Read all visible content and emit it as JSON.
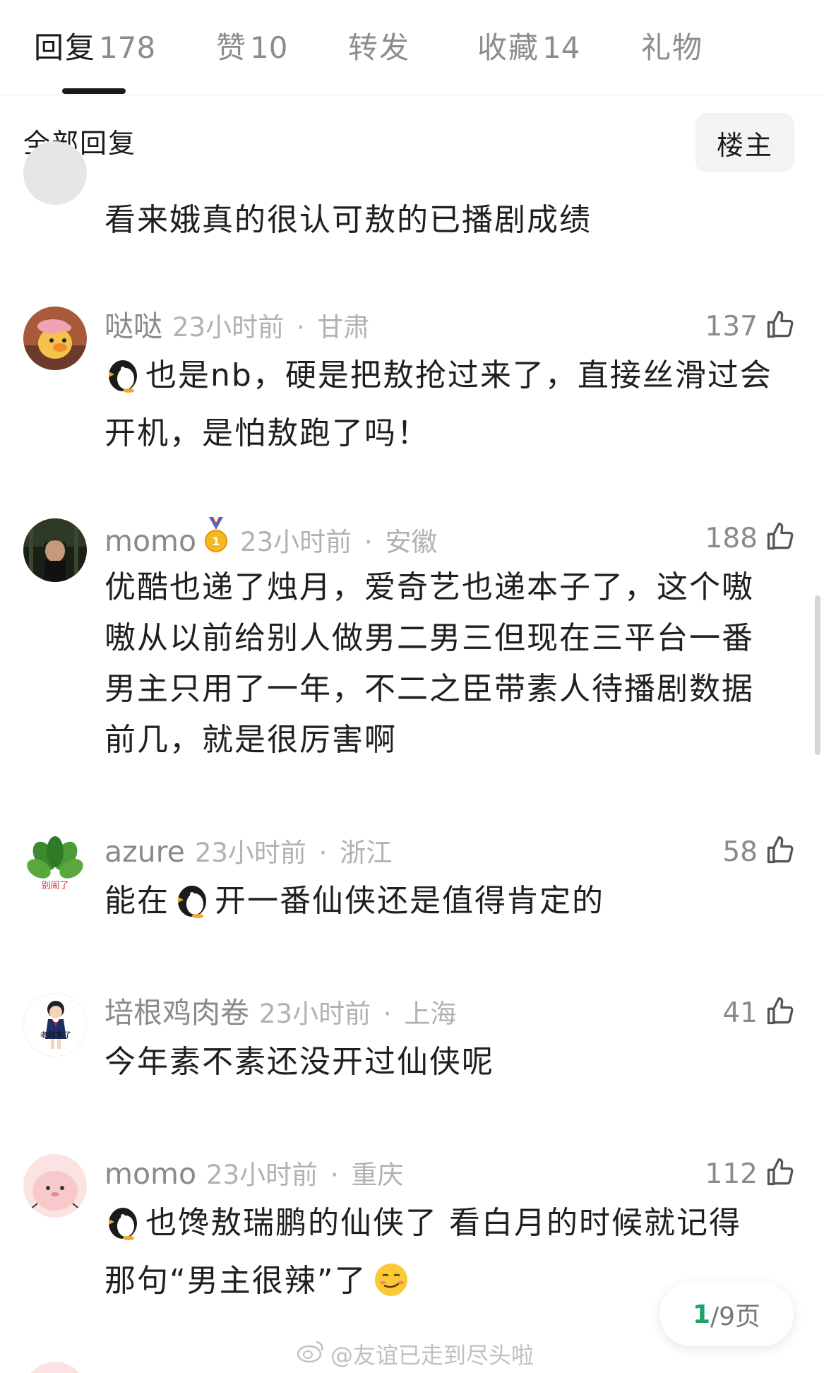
{
  "tabs": [
    {
      "label": "回复",
      "count": "178",
      "active": true
    },
    {
      "label": "赞",
      "count": "10",
      "active": false
    },
    {
      "label": "转发",
      "count": "",
      "active": false
    },
    {
      "label": "收藏",
      "count": "14",
      "active": false
    },
    {
      "label": "礼物",
      "count": "",
      "active": false
    }
  ],
  "filter": {
    "all_replies_label": "全部回复",
    "op_button_label": "楼主"
  },
  "comments": [
    {
      "username": "",
      "time": "",
      "location": "",
      "likes": "",
      "text": "看来娥真的很认可敖的已播剧成绩",
      "avatar": "gray-avatar"
    },
    {
      "username": "哒哒",
      "time": "23小时前",
      "location": "甘肃",
      "likes": "137",
      "text": "也是nb，硬是把敖抢过来了，直接丝滑过会开机，是怕敖跑了吗！",
      "avatar": "duck-avatar",
      "emoji": "penguin-icon"
    },
    {
      "username": "momo",
      "time": "23小时前",
      "location": "安徽",
      "likes": "188",
      "text": "优酷也递了烛月，爱奇艺也递本子了，这个嗷嗷从以前给别人做男二男三但现在三平台一番男主只用了一年，不二之臣带素人待播剧数据前几，就是很厉害啊",
      "avatar": "dark-portrait-avatar",
      "badge": "gold-medal-icon"
    },
    {
      "username": "azure",
      "time": "23小时前",
      "location": "浙江",
      "likes": "58",
      "text_before": "能在",
      "text_after": "开一番仙侠还是值得肯定的",
      "avatar": "plant-avatar",
      "avatar_caption": "别闹了",
      "emoji": "penguin-icon"
    },
    {
      "username": "培根鸡肉卷",
      "time": "23小时前",
      "location": "上海",
      "likes": "41",
      "text": "今年素不素还没开过仙侠呢",
      "avatar": "cartoon-girl-avatar",
      "avatar_caption": "老奴来了"
    },
    {
      "username": "momo",
      "time": "23小时前",
      "location": "重庆",
      "likes": "112",
      "text_before": "也馋敖瑞鹏的仙侠了 看白月的时候就记得那句“男主很辣”了",
      "avatar": "pink-blob-avatar",
      "emoji": "penguin-icon",
      "trailing_emoji": "smirk-face-icon"
    }
  ],
  "separator": " · ",
  "pagination": {
    "current": "1",
    "total_text": "/9页"
  },
  "watermark": "@友谊已走到尽头啦",
  "colors": {
    "text_primary": "#1f1f1f",
    "text_secondary": "#8a8a8a",
    "text_muted": "#b1b1b1",
    "page_accent": "#22a06b"
  }
}
